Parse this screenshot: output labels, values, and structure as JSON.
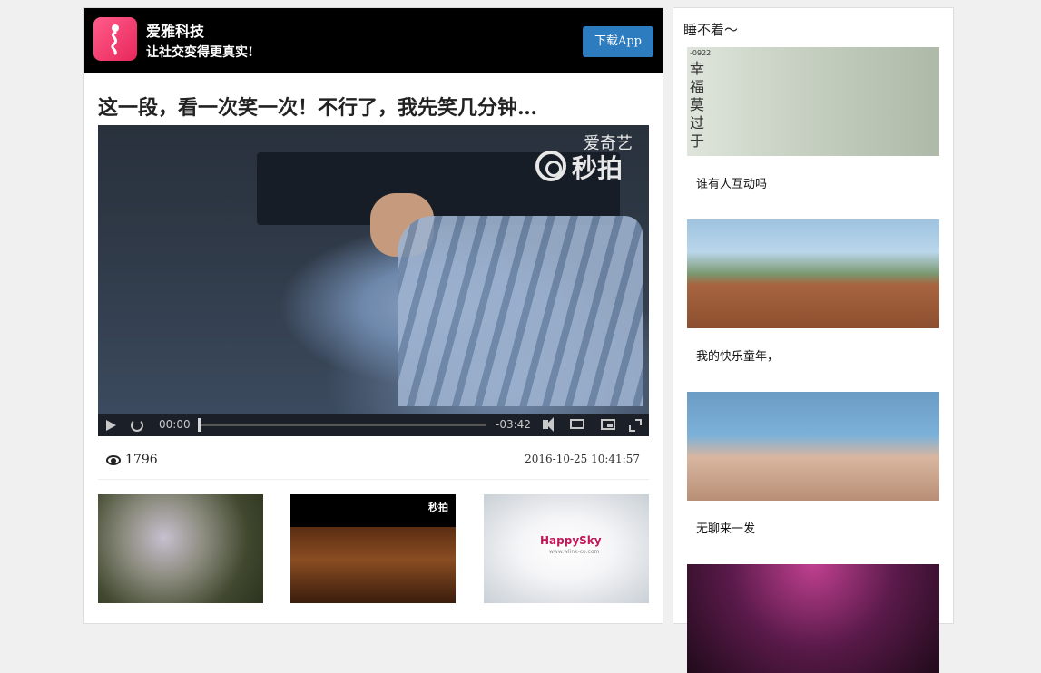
{
  "banner": {
    "app_name": "爱雅科技",
    "slogan": "让社交变得更真实!",
    "download_label": "下载App",
    "accent_color": "#2d7cc0",
    "logo_color": "#e8275c"
  },
  "post": {
    "title": "这一段，看一次笑一次！不行了，我先笑几分钟…",
    "views": "1796",
    "timestamp": "2016-10-25 10:41:57"
  },
  "video": {
    "watermark_top": "爱奇艺",
    "watermark_main": "秒拍",
    "current_time": "00:00",
    "remaining_time": "-03:42",
    "progress": 0
  },
  "related": {
    "thumb2_logo": "秒拍",
    "thumb3_logo": "HappySky",
    "thumb3_sub": "www.wlink-co.com"
  },
  "sidebar": {
    "title": "睡不着～",
    "items": [
      {
        "caption": "谁有人互动吗",
        "image_text": "幸福莫过于",
        "image_num": "-0922"
      },
      {
        "caption": "我的快乐童年，"
      },
      {
        "caption": "无聊来一发"
      },
      {
        "caption": ""
      }
    ]
  },
  "icons": {
    "play": "play-icon",
    "rewind": "rewind-15-icon",
    "volume": "volume-icon",
    "airplay": "airplay-icon",
    "pip": "picture-in-picture-icon",
    "fullscreen": "fullscreen-icon",
    "views": "eye-icon"
  }
}
